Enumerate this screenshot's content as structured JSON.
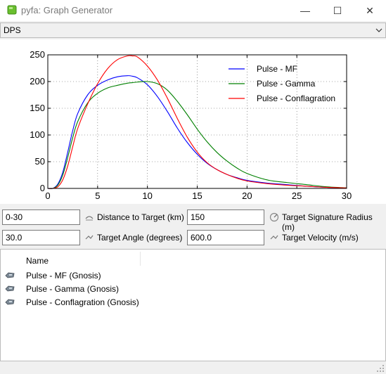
{
  "window": {
    "title": "pyfa: Graph Generator",
    "minimize_glyph": "—",
    "maximize_glyph": "☐",
    "close_glyph": "✕"
  },
  "graph_type": {
    "selected": "DPS"
  },
  "chart_data": {
    "type": "line",
    "title": "",
    "xlabel": "",
    "ylabel": "",
    "xlim": [
      0,
      30
    ],
    "ylim": [
      0,
      250
    ],
    "xticks": [
      0,
      5,
      10,
      15,
      20,
      25,
      30
    ],
    "yticks": [
      0,
      50,
      100,
      150,
      200,
      250
    ],
    "grid": true,
    "legend_position": "top-right",
    "x": [
      0,
      0.5,
      1,
      1.5,
      2,
      2.5,
      3,
      4,
      5,
      6,
      7,
      8,
      8.5,
      9,
      10,
      11,
      12,
      13,
      14,
      15,
      16,
      17,
      18,
      19,
      20,
      22,
      24,
      26,
      28,
      30
    ],
    "series": [
      {
        "name": "Pulse - MF",
        "color": "#0000ff",
        "values": [
          0,
          0,
          8,
          30,
          68,
          108,
          140,
          175,
          193,
          203,
          209,
          211,
          210,
          207,
          194,
          172,
          144,
          113,
          86,
          64,
          47,
          35,
          26,
          20,
          15,
          10,
          7,
          4,
          2,
          1
        ]
      },
      {
        "name": "Pulse - Gamma",
        "color": "#008000",
        "values": [
          0,
          0,
          6,
          25,
          58,
          95,
          125,
          160,
          178,
          188,
          193,
          197,
          198,
          199,
          200,
          196,
          184,
          163,
          138,
          111,
          87,
          67,
          51,
          38,
          28,
          16,
          11,
          7,
          3,
          1
        ]
      },
      {
        "name": "Pulse - Conflagration",
        "color": "#ff0000",
        "values": [
          0,
          0,
          3,
          16,
          42,
          78,
          112,
          158,
          196,
          224,
          241,
          248,
          248,
          246,
          229,
          203,
          169,
          131,
          96,
          68,
          48,
          35,
          26,
          19,
          14,
          9,
          6,
          4,
          2,
          1
        ]
      }
    ]
  },
  "params": {
    "distance": {
      "value": "0-30",
      "label": "Distance to Target (km)"
    },
    "signature": {
      "value": "150",
      "label": "Target Signature Radius (m)"
    },
    "angle": {
      "value": "30.0",
      "label": "Target Angle (degrees)"
    },
    "velocity": {
      "value": "600.0",
      "label": "Target Velocity (m/s)"
    }
  },
  "fit_list": {
    "column_header": "Name",
    "items": [
      {
        "label": "Pulse - MF (Gnosis)"
      },
      {
        "label": "Pulse - Gamma (Gnosis)"
      },
      {
        "label": "Pulse - Conflagration (Gnosis)"
      }
    ]
  }
}
